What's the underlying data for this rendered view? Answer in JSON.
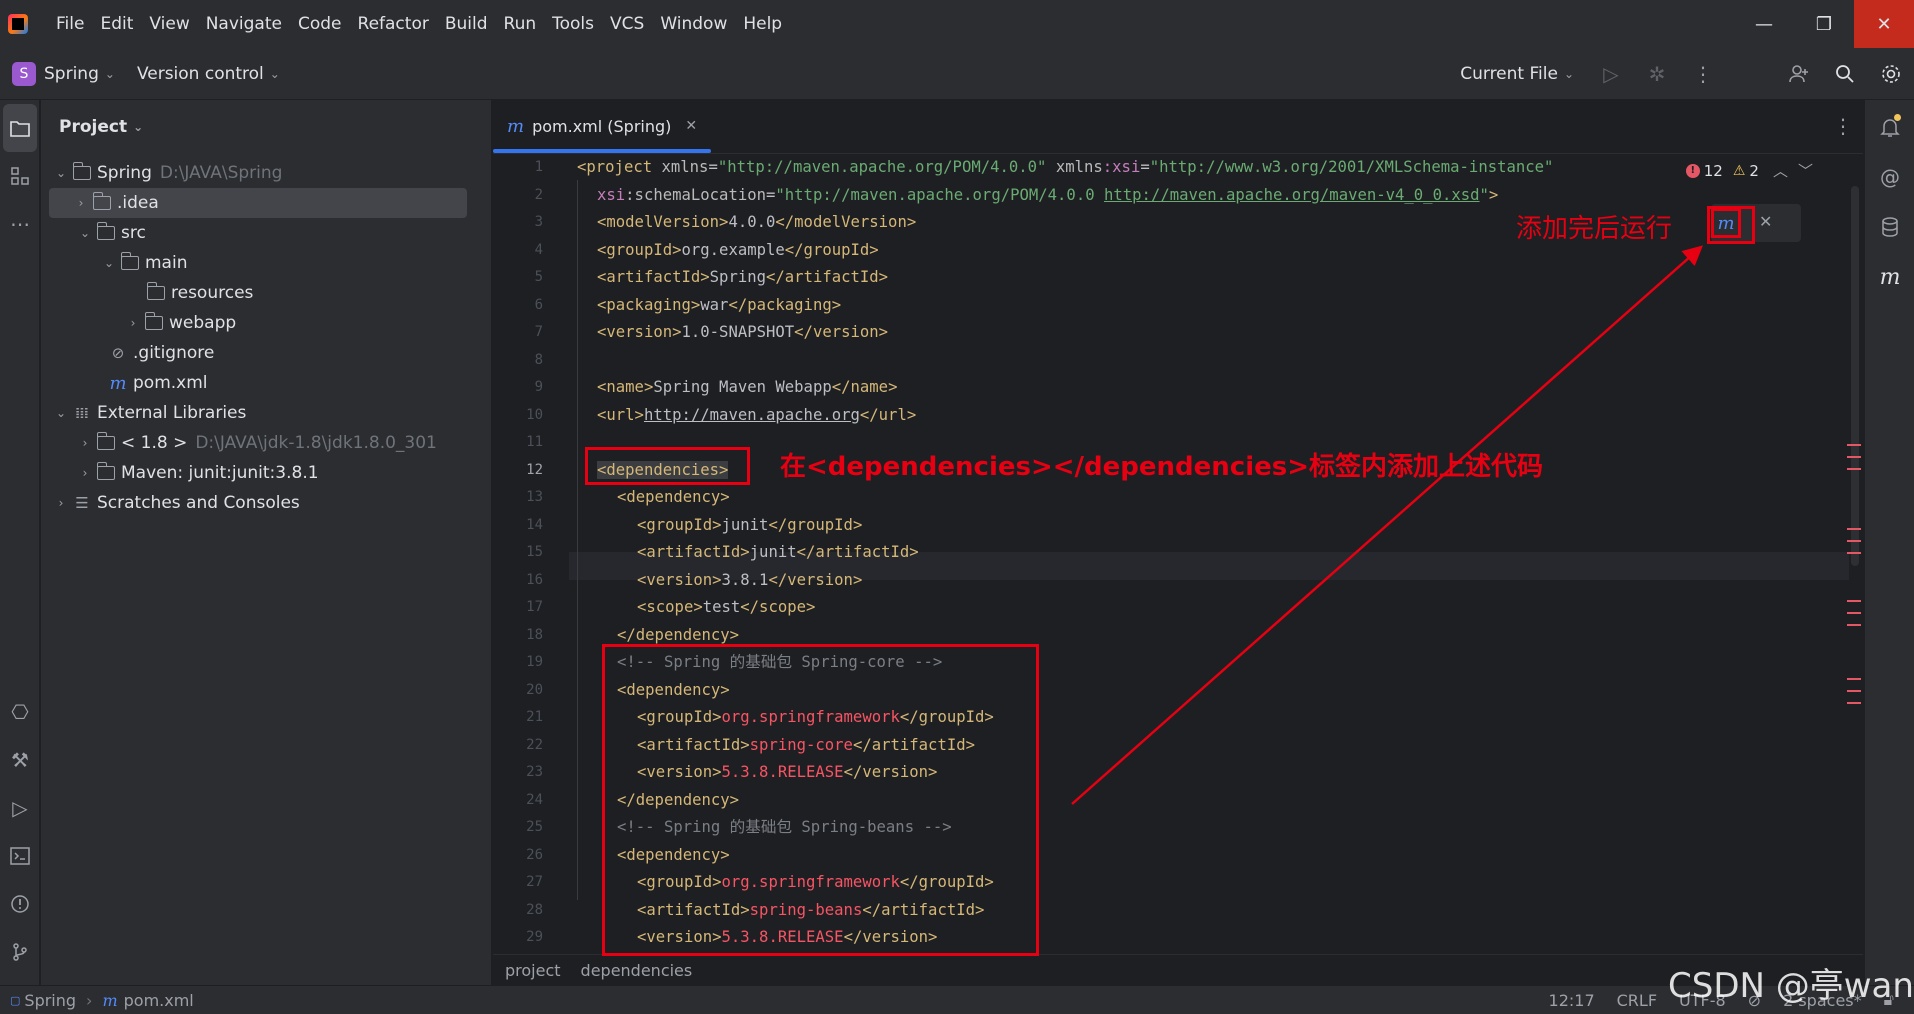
{
  "menu": [
    "File",
    "Edit",
    "View",
    "Navigate",
    "Code",
    "Refactor",
    "Build",
    "Run",
    "Tools",
    "VCS",
    "Window",
    "Help"
  ],
  "toolbar": {
    "project_badge": "S",
    "project_name": "Spring",
    "vcs_label": "Version control",
    "run_config": "Current File"
  },
  "project_panel": {
    "title": "Project",
    "tree": [
      {
        "label": "Spring",
        "extra": "D:\\JAVA\\Spring"
      },
      {
        "label": ".idea"
      },
      {
        "label": "src"
      },
      {
        "label": "main"
      },
      {
        "label": "resources"
      },
      {
        "label": "webapp"
      },
      {
        "label": ".gitignore"
      },
      {
        "label": "pom.xml"
      },
      {
        "label": "External Libraries"
      },
      {
        "label": "< 1.8 >",
        "extra": "D:\\JAVA\\jdk-1.8\\jdk1.8.0_301"
      },
      {
        "label": "Maven: junit:junit:3.8.1"
      },
      {
        "label": "Scratches and Consoles"
      }
    ]
  },
  "editor": {
    "tab_title": "pom.xml (Spring)",
    "errors": "12",
    "warnings": "2",
    "current_line": 12,
    "line_numbers": [
      "1",
      "2",
      "3",
      "4",
      "5",
      "6",
      "7",
      "8",
      "9",
      "10",
      "11",
      "12",
      "13",
      "14",
      "15",
      "16",
      "17",
      "18",
      "19",
      "20",
      "21",
      "22",
      "23",
      "24",
      "25",
      "26",
      "27",
      "28",
      "29"
    ],
    "code": {
      "l1_tag": "<project ",
      "l1_a1": "xmlns",
      "l1_eq1": "=",
      "l1_v1": "\"http://maven.apache.org/POM/4.0.0\"",
      "l1_a2ns": "xmlns",
      "l1_a2": ":xsi",
      "l1_eq2": "=",
      "l1_v2": "\"http://www.w3.org/2001/XMLSchema-instance\"",
      "l2_ns": "xsi",
      "l2_a": ":schemaLocation",
      "l2_eq": "=",
      "l2_v1": "\"http://maven.apache.org/POM/4.0.0 ",
      "l2_v2": "http://maven.apache.org/maven-v4_0_0.xsd",
      "l2_v3": "\"",
      "l2_close": ">",
      "l3": [
        "<modelVersion>",
        "4.0.0",
        "</modelVersion>"
      ],
      "l4": [
        "<groupId>",
        "org.example",
        "</groupId>"
      ],
      "l5": [
        "<artifactId>",
        "Spring",
        "</artifactId>"
      ],
      "l6": [
        "<packaging>",
        "war",
        "</packaging>"
      ],
      "l7": [
        "<version>",
        "1.0-SNAPSHOT",
        "</version>"
      ],
      "l9": [
        "<name>",
        "Spring Maven Webapp",
        "</name>"
      ],
      "l10": [
        "<url>",
        "http://maven.apache.org",
        "</url>"
      ],
      "l12": "<dependencies>",
      "l13": "<dependency>",
      "l14": [
        "<groupId>",
        "junit",
        "</groupId>"
      ],
      "l15": [
        "<artifactId>",
        "junit",
        "</artifactId>"
      ],
      "l16": [
        "<version>",
        "3.8.1",
        "</version>"
      ],
      "l17": [
        "<scope>",
        "test",
        "</scope>"
      ],
      "l18": "</dependency>",
      "l19": "<!-- Spring 的基础包 Spring-core -->",
      "l20": "<dependency>",
      "l21": [
        "<groupId>",
        "org.springframework",
        "</groupId>"
      ],
      "l22": [
        "<artifactId>",
        "spring-core",
        "</artifactId>"
      ],
      "l23": [
        "<version>",
        "5.3.8.RELEASE",
        "</version>"
      ],
      "l24": "</dependency>",
      "l25": "<!-- Spring 的基础包 Spring-beans -->",
      "l26": "<dependency>",
      "l27": [
        "<groupId>",
        "org.springframework",
        "</groupId>"
      ],
      "l28": [
        "<artifactId>",
        "spring-beans",
        "</artifactId>"
      ],
      "l29": [
        "<version>",
        "5.3.8.RELEASE",
        "</version>"
      ]
    },
    "maven_popup_icon": "m",
    "breadcrumbs": [
      "project",
      "dependencies"
    ]
  },
  "annotations": {
    "dependencies_note_prefix": "在",
    "dependencies_note_tag": "<dependencies></dependencies>",
    "dependencies_note_suffix": "标签内添加上述代码",
    "run_note": "添加完后运行",
    "accent": "#e60012"
  },
  "statusbar": {
    "project": "Spring",
    "file": "pom.xml",
    "position": "12:17",
    "line_sep": "CRLF",
    "encoding": "UTF-8",
    "indent": "2 spaces*"
  },
  "watermark": "CSDN @亭wan"
}
